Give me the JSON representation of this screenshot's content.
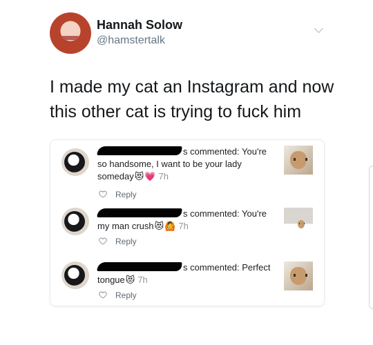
{
  "tweet": {
    "author_name": "Hannah Solow",
    "author_handle": "@hamstertalk",
    "text": "I made my cat an Instagram and now this other cat is trying to fuck him"
  },
  "embedded_card": {
    "comments": [
      {
        "prefix": "s commented: You're",
        "body": "so handsome, I want to be your lady someday",
        "emojis": [
          "😻",
          "💗"
        ],
        "time": "7h",
        "reply": "Reply"
      },
      {
        "prefix": "s commented: You're",
        "body": "my man crush",
        "emojis": [
          "😻",
          "🙆"
        ],
        "time": "7h",
        "reply": "Reply"
      },
      {
        "prefix": "s commented: Perfect",
        "body": "tongue",
        "emojis": [
          "😻"
        ],
        "time": "7h",
        "reply": "Reply"
      }
    ]
  },
  "icons": {
    "chevron": "chevron-down-icon",
    "heart": "heart-outline-icon"
  },
  "colors": {
    "text": "#14171a",
    "muted": "#657786",
    "card_border": "#e9ebee",
    "redaction": "#030303"
  }
}
